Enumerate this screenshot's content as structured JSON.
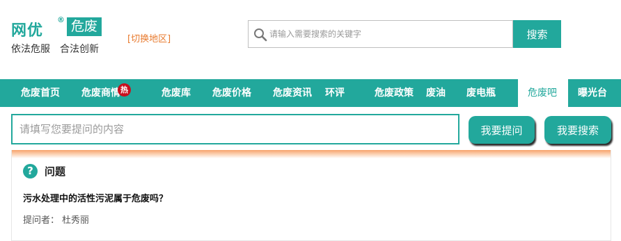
{
  "header": {
    "logo_brand": "网优",
    "logo_registered": "®",
    "logo_tag": "危废",
    "slogan": "依法危服　合法创新",
    "region_link": "[切换地区]",
    "search_placeholder": "请输入需要搜索的关键字",
    "search_button": "搜索"
  },
  "nav": {
    "items": [
      {
        "label": "危废首页"
      },
      {
        "label": "危废商情",
        "badge": "热"
      },
      {
        "label": "危废库"
      },
      {
        "label": "危废价格"
      },
      {
        "label": "危废资讯"
      },
      {
        "label": "环评"
      },
      {
        "label": "危废政策"
      },
      {
        "label": "废油"
      },
      {
        "label": "废电瓶"
      },
      {
        "label": "危废吧",
        "active": true
      },
      {
        "label": "曝光台"
      }
    ]
  },
  "ask": {
    "placeholder": "请填写您要提问的内容",
    "ask_button": "我要提问",
    "search_button": "我要搜索"
  },
  "question": {
    "icon_glyph": "?",
    "heading": "问题",
    "title": "污水处理中的活性污泥属于危废吗？",
    "asker_label": "提问者：",
    "asker_name": "杜秀丽"
  },
  "colors": {
    "primary": "#22a89c",
    "accent_orange": "#e87a2e",
    "hot_badge": "#c8101e"
  }
}
